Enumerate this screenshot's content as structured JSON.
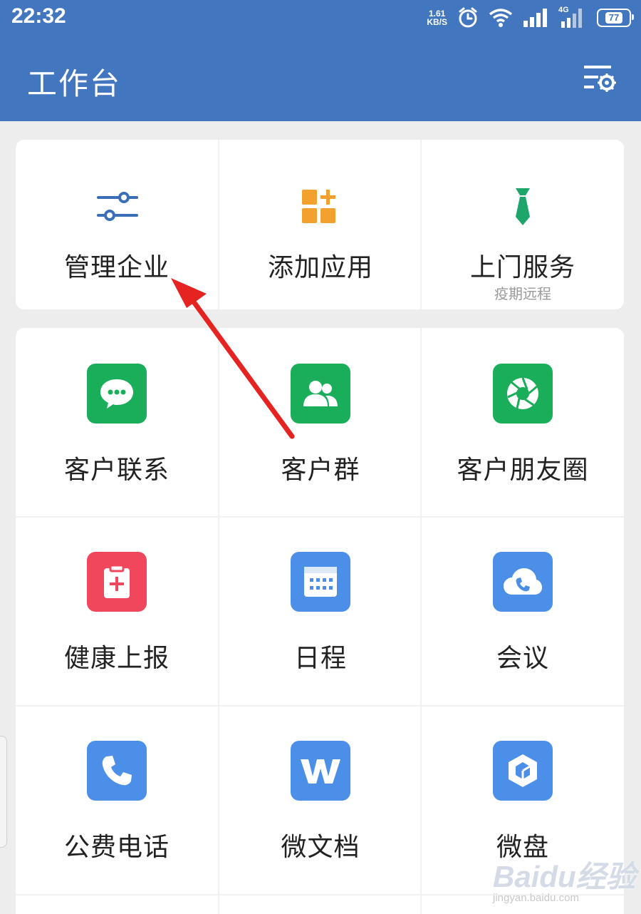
{
  "status_bar": {
    "time": "22:32",
    "net_speed_value": "1.61",
    "net_speed_unit": "KB/S",
    "network_type": "4G",
    "battery": "77"
  },
  "header": {
    "title": "工作台",
    "settings_icon": "list-settings-icon"
  },
  "top_tools": [
    {
      "label": "管理企业",
      "icon": "sliders-icon",
      "color": "#3a6fb8"
    },
    {
      "label": "添加应用",
      "icon": "add-app-icon",
      "color": "#f2a12f"
    },
    {
      "label": "上门服务",
      "sublabel": "疫期远程",
      "icon": "tie-icon",
      "color": "#1ea66a"
    }
  ],
  "apps": [
    {
      "label": "客户联系",
      "icon": "chat-bubble-icon",
      "color": "#1aad5a"
    },
    {
      "label": "客户群",
      "icon": "group-icon",
      "color": "#1aad5a"
    },
    {
      "label": "客户朋友圈",
      "icon": "aperture-icon",
      "color": "#1aad5a"
    },
    {
      "label": "健康上报",
      "icon": "medical-clipboard-icon",
      "color": "#f1475d"
    },
    {
      "label": "日程",
      "icon": "calendar-icon",
      "color": "#4c8fe8"
    },
    {
      "label": "会议",
      "icon": "cloud-phone-icon",
      "color": "#4c8fe8"
    },
    {
      "label": "公费电话",
      "icon": "phone-icon",
      "color": "#4c8fe8"
    },
    {
      "label": "微文档",
      "icon": "w-doc-icon",
      "color": "#4c8fe8"
    },
    {
      "label": "微盘",
      "icon": "cube-drive-icon",
      "color": "#4c8fe8"
    }
  ],
  "watermark": {
    "text": "Baidu经验",
    "url": "jingyan.baidu.com"
  },
  "annotation": {
    "arrow_color": "#e52421"
  }
}
